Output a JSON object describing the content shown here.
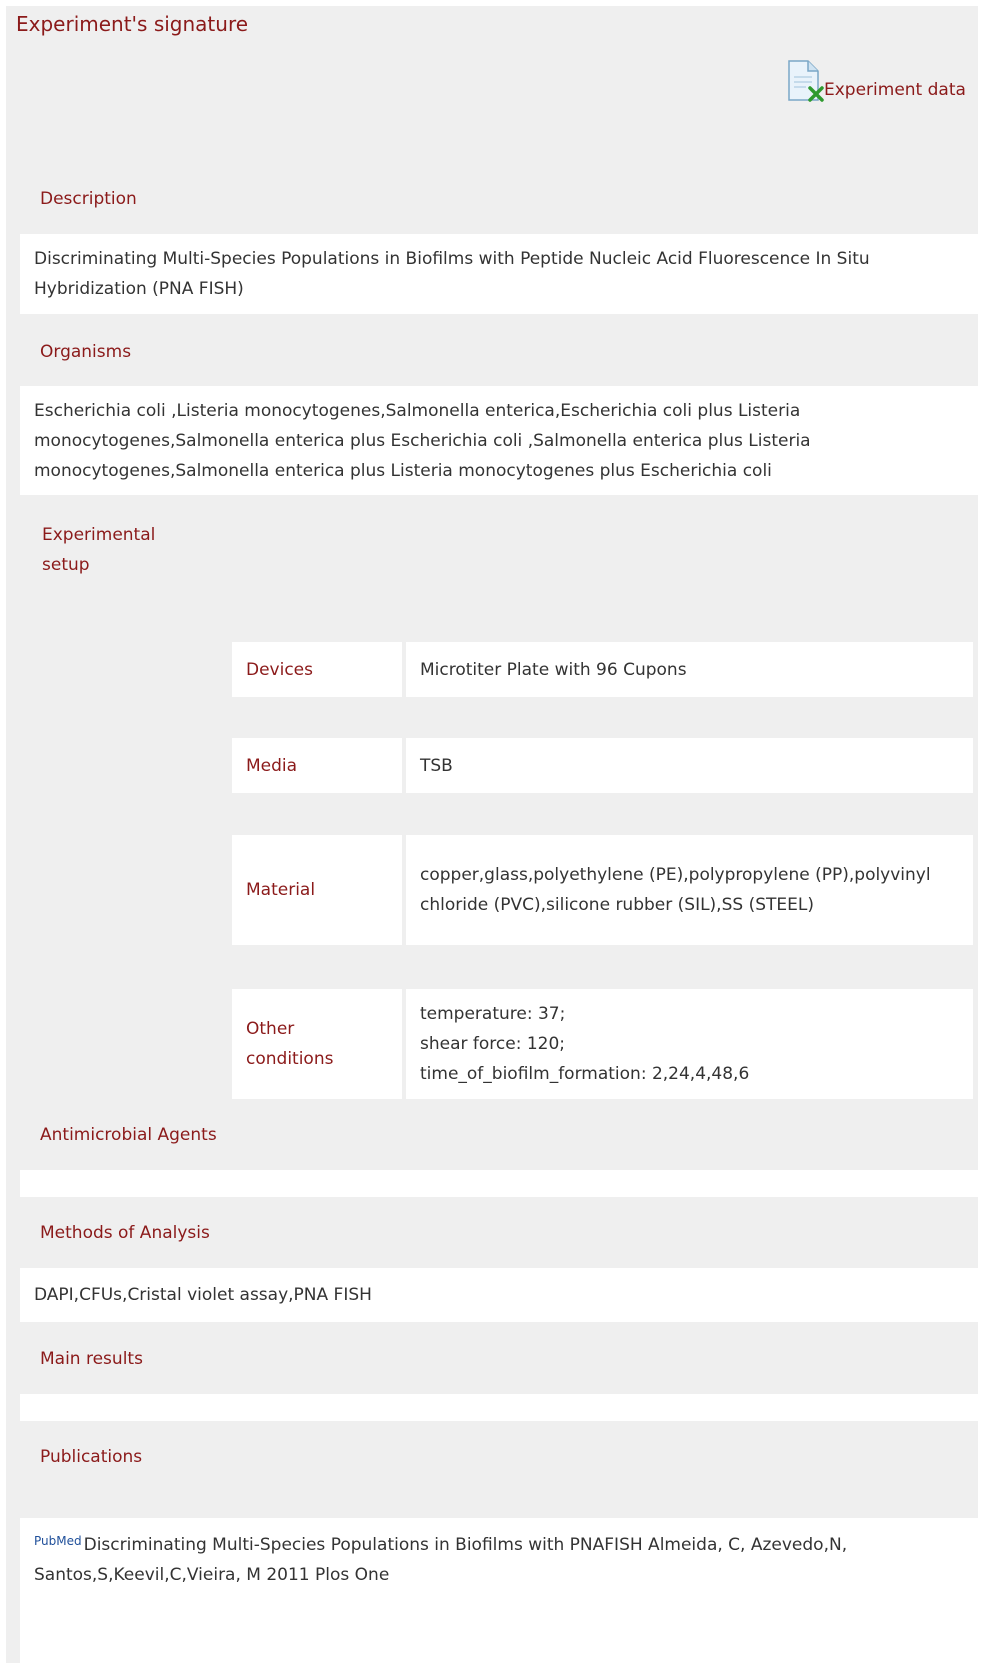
{
  "header": {
    "title": "Experiment's signature",
    "experiment_data_label": "Experiment data",
    "experiment_data_icon": "excel-file-icon"
  },
  "description": {
    "label": "Description",
    "text": "Discriminating Multi-Species Populations in Biofilms with Peptide Nucleic Acid Fluorescence In Situ Hybridization (PNA FISH)"
  },
  "organisms": {
    "label": "Organisms",
    "text": "Escherichia coli ,Listeria monocytogenes,Salmonella enterica,Escherichia coli plus Listeria monocytogenes,Salmonella enterica plus Escherichia coli ,Salmonella enterica plus Listeria monocytogenes,Salmonella enterica plus Listeria monocytogenes plus Escherichia coli"
  },
  "experimental_setup": {
    "label_line1": "Experimental",
    "label_line2": "setup",
    "rows": [
      {
        "key": "Devices",
        "value": "Microtiter Plate with 96 Cupons"
      },
      {
        "key": "Media",
        "value": "TSB"
      },
      {
        "key": "Material",
        "value": "copper,glass,polyethylene (PE),polypropylene (PP),polyvinyl chloride (PVC),silicone rubber (SIL),SS (STEEL)"
      },
      {
        "key_line1": "Other",
        "key_line2": "conditions",
        "value_lines": [
          "temperature: 37;",
          "shear force: 120;",
          "time_of_biofilm_formation: 2,24,4,48,6"
        ]
      }
    ]
  },
  "antimicrobial_agents": {
    "label": "Antimicrobial Agents",
    "text": ""
  },
  "methods_of_analysis": {
    "label": "Methods of Analysis",
    "text": "DAPI,CFUs,Cristal violet assay,PNA FISH"
  },
  "main_results": {
    "label": "Main results",
    "text": ""
  },
  "publications": {
    "label": "Publications",
    "logo_text": "PubMed",
    "title": "Discriminating Multi-Species Populations in Biofilms with PNAFISH",
    "authors_line1": " Almeida, C, Azevedo,N,",
    "authors_line2": "Santos,S,Keevil,C,Vieira, M 2011 Plos One"
  },
  "colors": {
    "label_red": "#8b1a1a",
    "panel_bg": "#efefef",
    "box_bg": "#ffffff",
    "text": "#333333"
  }
}
